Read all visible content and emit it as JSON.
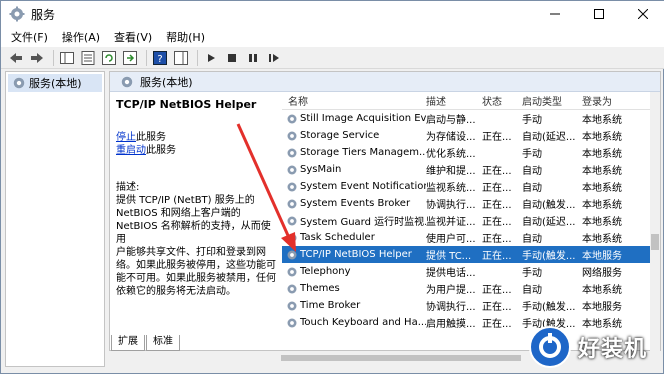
{
  "window": {
    "title": "服务"
  },
  "menu": [
    "文件(F)",
    "操作(A)",
    "查看(V)",
    "帮助(H)"
  ],
  "tree": {
    "root_label": "服务(本地)"
  },
  "main": {
    "header": "服务(本地)",
    "selected_service": "TCP/IP NetBIOS Helper",
    "stop_link": "停止",
    "stop_suffix": "此服务",
    "restart_link": "重启动",
    "restart_suffix": "此服务",
    "desc_label": "描述:",
    "desc_lines": [
      "提供 TCP/IP (NetBT) 服务上的",
      "NetBIOS 和网络上客户端的",
      "NetBIOS 名称解析的支持，从而使用",
      "户能够共享文件、打印和登录到网",
      "络。如果此服务被停用，这些功能可",
      "能不可用。如果此服务被禁用，任何",
      "依赖它的服务将无法启动。"
    ]
  },
  "table": {
    "columns": [
      "名称",
      "描述",
      "状态",
      "启动类型",
      "登录为"
    ],
    "rows": [
      {
        "name": "Still Image Acquisition Ev...",
        "desc": "启动与静...",
        "status": "",
        "startup": "手动",
        "logon": "本地系统"
      },
      {
        "name": "Storage Service",
        "desc": "为存储设...",
        "status": "正在...",
        "startup": "自动(延迟...",
        "logon": "本地系统"
      },
      {
        "name": "Storage Tiers Managem...",
        "desc": "优化系统...",
        "status": "",
        "startup": "手动",
        "logon": "本地系统"
      },
      {
        "name": "SysMain",
        "desc": "维护和提...",
        "status": "正在...",
        "startup": "自动",
        "logon": "本地系统"
      },
      {
        "name": "System Event Notification...",
        "desc": "监视系统...",
        "status": "正在...",
        "startup": "自动",
        "logon": "本地系统"
      },
      {
        "name": "System Events Broker",
        "desc": "协调执行...",
        "status": "正在...",
        "startup": "自动(触发...",
        "logon": "本地系统"
      },
      {
        "name": "System Guard 运行时监视...",
        "desc": "监视并证...",
        "status": "正在...",
        "startup": "自动(延迟...",
        "logon": "本地系统"
      },
      {
        "name": "Task Scheduler",
        "desc": "使用户可...",
        "status": "正在...",
        "startup": "自动",
        "logon": "本地系统"
      },
      {
        "name": "TCP/IP NetBIOS Helper",
        "desc": "提供 TC...",
        "status": "正在...",
        "startup": "手动(触发...",
        "logon": "本地服务"
      },
      {
        "name": "Telephony",
        "desc": "提供电话...",
        "status": "",
        "startup": "手动",
        "logon": "网络服务"
      },
      {
        "name": "Themes",
        "desc": "为用户提...",
        "status": "正在...",
        "startup": "自动",
        "logon": "本地系统"
      },
      {
        "name": "Time Broker",
        "desc": "协调执行...",
        "status": "正在...",
        "startup": "手动(触发...",
        "logon": "本地服务"
      },
      {
        "name": "Touch Keyboard and Ha...",
        "desc": "启用触摸...",
        "status": "正在...",
        "startup": "手动(触发...",
        "logon": "本地系统"
      }
    ],
    "selected_index": 8
  },
  "tabs": [
    "扩展",
    "标准"
  ],
  "watermark": {
    "text": "好装机"
  },
  "colors": {
    "selection": "#1f6fc2",
    "arrow": "#e3302b",
    "link": "#0033cc"
  }
}
